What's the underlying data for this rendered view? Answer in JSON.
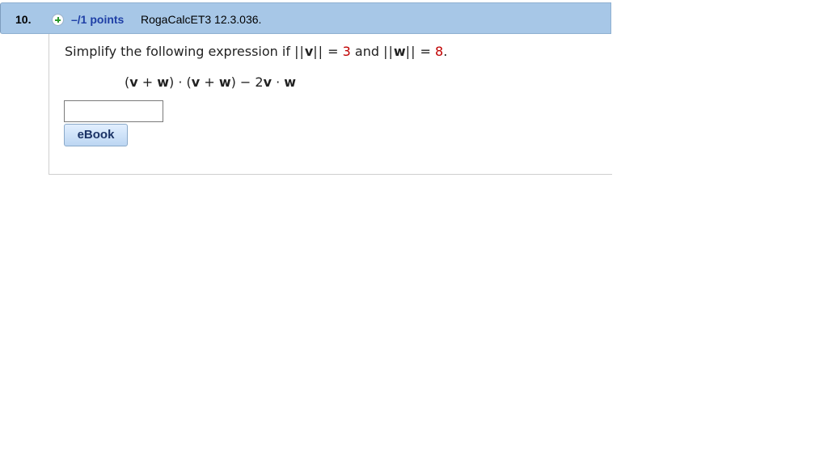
{
  "question": {
    "number": "10.",
    "points": "–/1 points",
    "code": "RogaCalcET3 12.3.036."
  },
  "prompt": {
    "text_before": "Simplify the following expression if ",
    "norm_open": "||",
    "v": "v",
    "norm_close": "||",
    "equals1": " = ",
    "v_value": "3",
    "and_text": " and ",
    "w": "w",
    "equals2": " = ",
    "w_value": "8",
    "period": "."
  },
  "expression": {
    "p1": "(",
    "v1": "v",
    "plus1": " + ",
    "w1": "w",
    "p2": ") · (",
    "v2": "v",
    "plus2": " + ",
    "w2": "w",
    "p3": ") − 2",
    "v3": "v",
    "dot": " · ",
    "w3": "w"
  },
  "answer": {
    "value": ""
  },
  "buttons": {
    "ebook": "eBook"
  },
  "colors": {
    "header_bg": "#a7c7e7",
    "points_text": "#1f3fa6",
    "value_red": "#c00000",
    "button_text": "#1b3366"
  },
  "icons": {
    "add": "plus-circle-icon"
  }
}
